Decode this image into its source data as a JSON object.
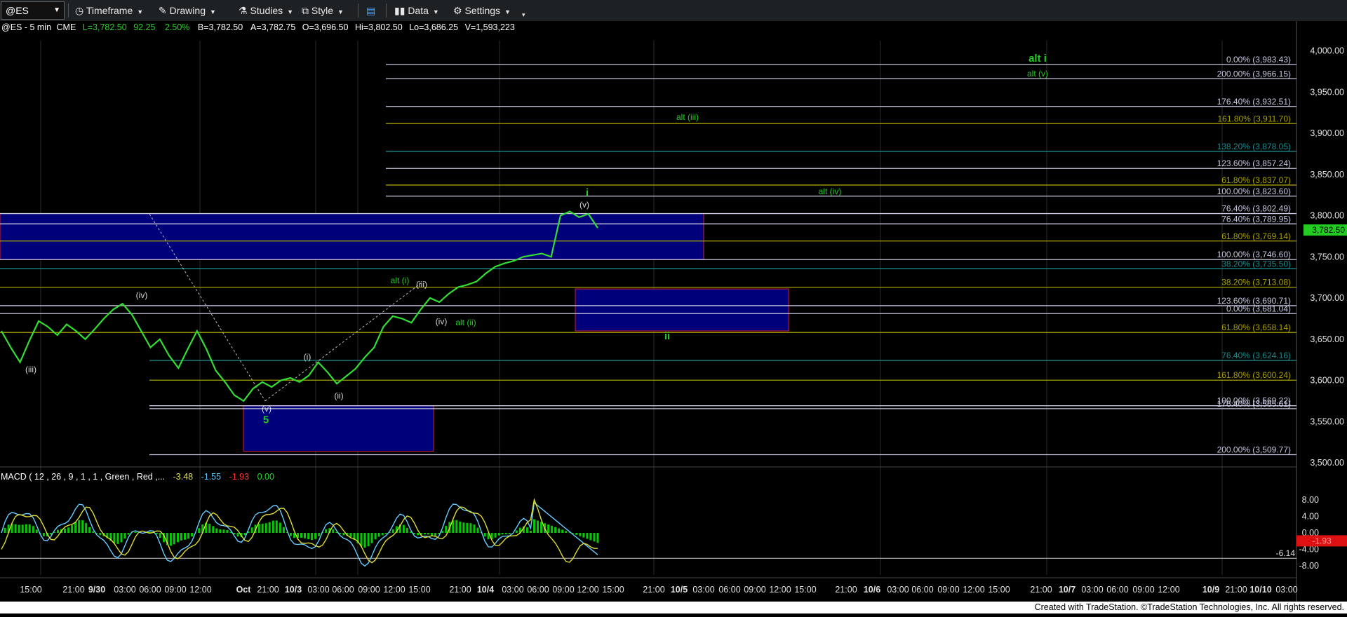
{
  "toolbar": {
    "symbol": "@ES",
    "timeframe": "Timeframe",
    "drawing": "Drawing",
    "studies": "Studies",
    "style": "Style",
    "data": "Data",
    "settings": "Settings"
  },
  "status": {
    "symbol": "@ES - 5 min",
    "exchange": "CME",
    "last": "L=3,782.50",
    "change": "92.25",
    "pct": "2.50%",
    "bid": "B=3,782.50",
    "ask": "A=3,782.75",
    "open": "O=3,696.50",
    "high": "Hi=3,802.50",
    "low": "Lo=3,686.25",
    "volume": "V=1,593,223"
  },
  "macd": {
    "label": "MACD ( 12 , 26 , 9 , 1 , 1 , Green , Red ,...",
    "v1": "-3.48",
    "v2": "-1.55",
    "v3": "-1.93",
    "v4": "0.00",
    "current": "-1.93",
    "marker": "-6.14"
  },
  "footer": "Created with TradeStation. ©TradeStation Technologies, Inc. All rights reserved.",
  "colors": {
    "background": "#000000",
    "price": "#33dd33",
    "macd_line": "#66ccff",
    "signal_line": "#dddd33",
    "hist_pos": "#00ee00",
    "hist_neg": "#ee1111",
    "box_fill": "#00007a",
    "box_border": "#cc2233",
    "wave_label": "#22cc22"
  },
  "chart_data": {
    "type": "line",
    "symbol": "@ES",
    "interval": "5 min",
    "ylim": [
      3480,
      4010
    ],
    "y_ticks": [
      3500,
      3550,
      3600,
      3650,
      3700,
      3750,
      3800,
      3850,
      3900,
      3950,
      4000
    ],
    "y_tick_labels": [
      "3,500.00",
      "3,550.00",
      "3,600.00",
      "3,650.00",
      "3,700.00",
      "3,750.00",
      "3,800.00",
      "3,850.00",
      "3,900.00",
      "3,950.00",
      "4,000.00"
    ],
    "last_price_label": "3,782.50",
    "x_labels": [
      "15:00",
      "21:00",
      "9/30",
      "03:00",
      "06:00",
      "09:00",
      "12:00",
      "Oct",
      "21:00",
      "10/3",
      "03:00",
      "06:00",
      "09:00",
      "12:00",
      "15:00",
      "21:00",
      "10/4",
      "03:00",
      "06:00",
      "09:00",
      "12:00",
      "15:00",
      "21:00",
      "10/5",
      "03:00",
      "06:00",
      "09:00",
      "12:00",
      "15:00",
      "21:00",
      "10/6",
      "03:00",
      "06:00",
      "09:00",
      "12:00",
      "15:00",
      "21:00",
      "10/7",
      "03:00",
      "06:00",
      "09:00",
      "12:00",
      "10/9",
      "21:00",
      "10/10",
      "03:00"
    ],
    "price_path": [
      3660,
      3640,
      3622,
      3648,
      3672,
      3665,
      3655,
      3668,
      3660,
      3650,
      3662,
      3675,
      3686,
      3693,
      3680,
      3660,
      3640,
      3650,
      3630,
      3615,
      3638,
      3660,
      3638,
      3612,
      3598,
      3582,
      3575,
      3590,
      3598,
      3592,
      3600,
      3603,
      3598,
      3606,
      3622,
      3610,
      3596,
      3605,
      3614,
      3628,
      3640,
      3665,
      3678,
      3675,
      3670,
      3686,
      3700,
      3695,
      3705,
      3713,
      3716,
      3720,
      3730,
      3738,
      3742,
      3745,
      3750,
      3752,
      3754,
      3750,
      3800,
      3805,
      3798,
      3802,
      3785
    ],
    "fib_levels": [
      {
        "label": "0.00% (3,983.43)",
        "value": 3983.43
      },
      {
        "label": "200.00% (3,966.15)",
        "value": 3966.15
      },
      {
        "label": "176.40% (3,932.51)",
        "value": 3932.51
      },
      {
        "label": "161.80% (3,911.70)",
        "value": 3911.7
      },
      {
        "label": "138.20% (3,878.05)",
        "value": 3878.05
      },
      {
        "label": "123.60% (3,857.24)",
        "value": 3857.24
      },
      {
        "label": "61.80% (3,837.07)",
        "value": 3837.07
      },
      {
        "label": "100.00% (3,823.60)",
        "value": 3823.6
      },
      {
        "label": "76.40% (3,802.49)",
        "value": 3802.49
      },
      {
        "label": "76.40% (3,789.95)",
        "value": 3789.95
      },
      {
        "label": "61.80% (3,769.14)",
        "value": 3769.14
      },
      {
        "label": "100.00% (3,746.60)",
        "value": 3746.6
      },
      {
        "label": "38.20% (3,735.50)",
        "value": 3735.5
      },
      {
        "label": "38.20% (3,713.08)",
        "value": 3713.08
      },
      {
        "label": "123.60% (3,690.71)",
        "value": 3690.71
      },
      {
        "label": "0.00% (3,681.04)",
        "value": 3681.04
      },
      {
        "label": "61.80% (3,658.14)",
        "value": 3658.14
      },
      {
        "label": "76.40% (3,624.16)",
        "value": 3624.16
      },
      {
        "label": "161.80% (3,600.24)",
        "value": 3600.24
      },
      {
        "label": "100.00% (3,569.22)",
        "value": 3569.22
      },
      {
        "label": "176.40% (3,565.61)",
        "value": 3565.61
      },
      {
        "label": "200.00% (3,509.77)",
        "value": 3509.77
      }
    ],
    "wave_labels": [
      {
        "text": "(iii)",
        "price": 3610
      },
      {
        "text": "(iv)",
        "price": 3700
      },
      {
        "text": "(i)",
        "price": 3625
      },
      {
        "text": "(ii)",
        "price": 3578
      },
      {
        "text": "(v)",
        "price": 3562
      },
      {
        "text": "5",
        "price": 3548
      },
      {
        "text": "alt (i)",
        "price": 3718
      },
      {
        "text": "(iii)",
        "price": 3713
      },
      {
        "text": "(iv)",
        "price": 3668
      },
      {
        "text": "alt (ii)",
        "price": 3667
      },
      {
        "text": "(v)",
        "price": 3810
      },
      {
        "text": "i",
        "price": 3824
      },
      {
        "text": "ii",
        "price": 3650
      },
      {
        "text": "alt (iii)",
        "price": 3916
      },
      {
        "text": "alt (iv)",
        "price": 3826
      },
      {
        "text": "alt i",
        "price": 3987
      },
      {
        "text": "alt (v)",
        "price": 3969
      }
    ],
    "macd_ylim": [
      -9.5,
      11.5
    ],
    "macd_ticks": [
      8,
      4,
      0,
      -4,
      -8
    ],
    "macd_tick_labels": [
      "8.00",
      "4.00",
      "0.00",
      "-4.00",
      "-8.00"
    ]
  }
}
